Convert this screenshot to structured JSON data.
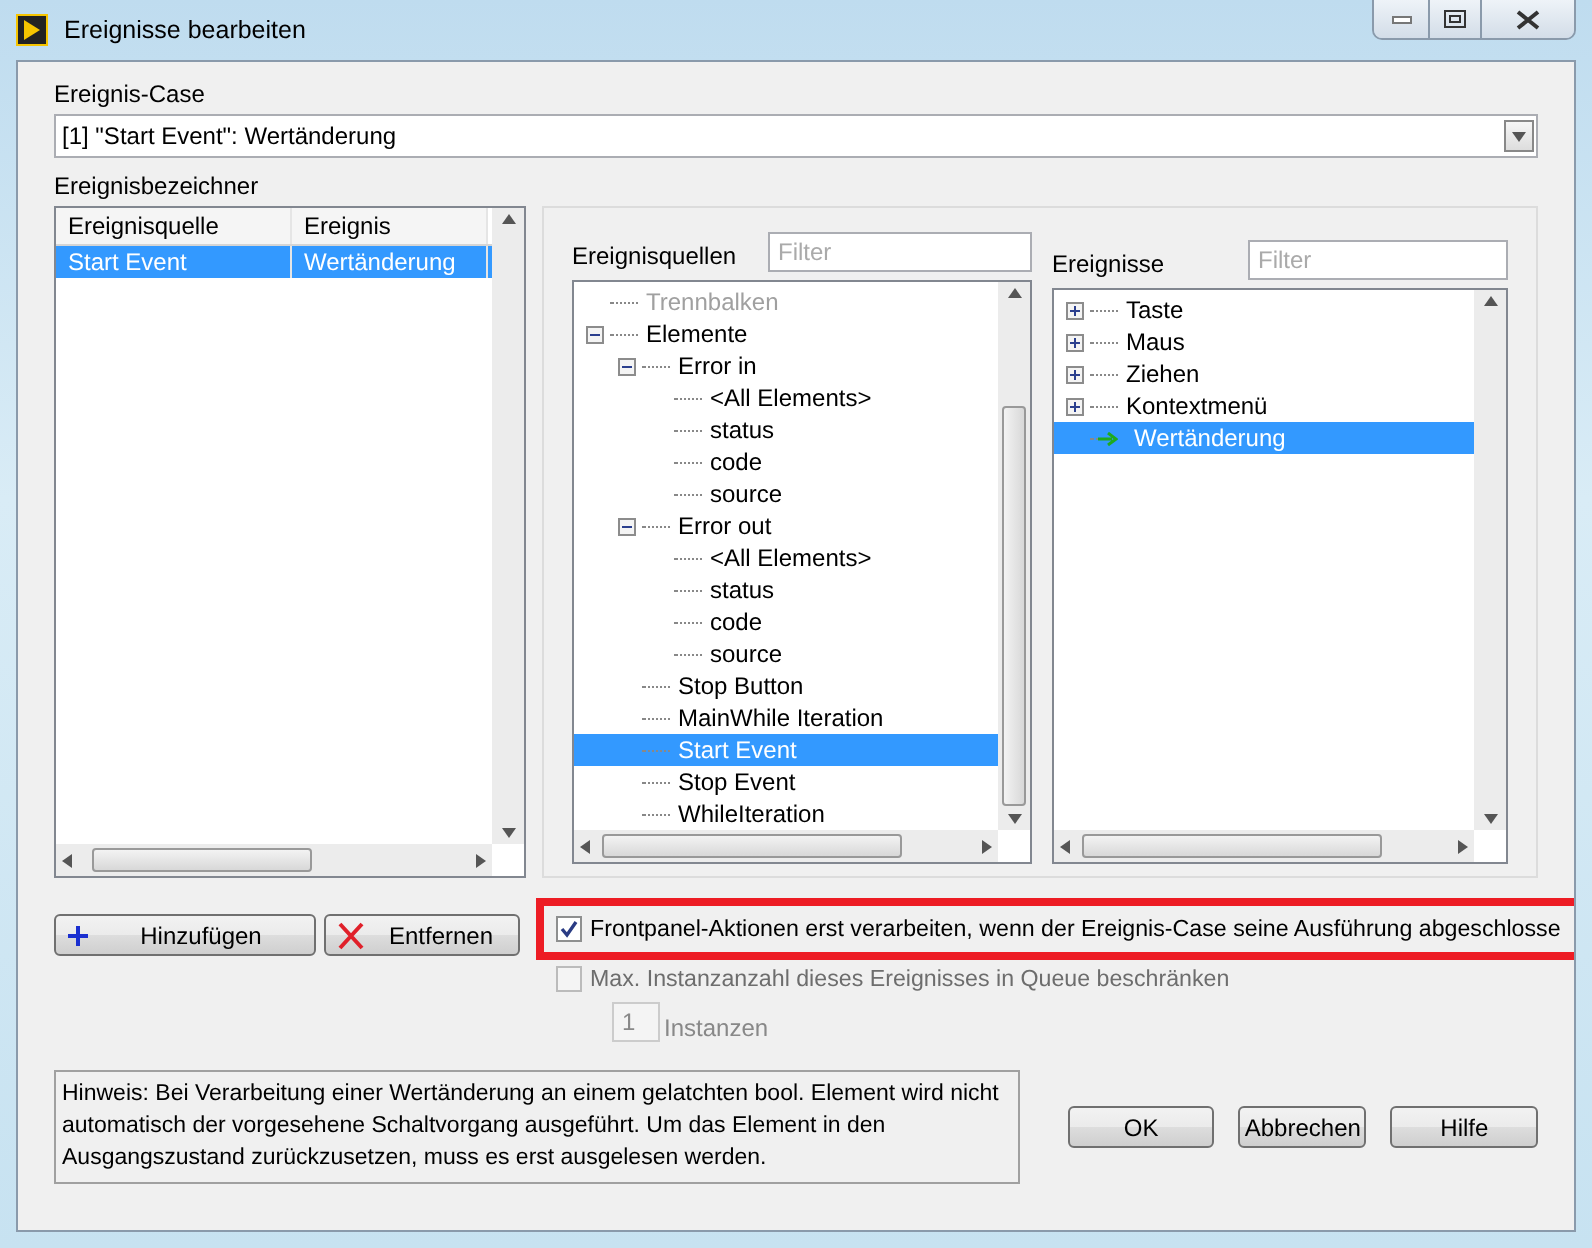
{
  "window": {
    "title": "Ereignisse bearbeiten"
  },
  "event_case": {
    "label": "Ereignis-Case",
    "value": "[1] \"Start Event\": Wertänderung"
  },
  "identifiers": {
    "label": "Ereignisbezeichner",
    "columns": [
      "Ereignisquelle",
      "Ereignis"
    ],
    "rows": [
      {
        "cells": [
          "Start Event",
          "Wertänderung"
        ],
        "selected": true
      }
    ]
  },
  "sources": {
    "label": "Ereignisquellen",
    "filter_placeholder": "Filter",
    "tree": [
      {
        "label": "Trennbalken",
        "disabled": true,
        "selected": false
      },
      {
        "label": "Elemente",
        "disabled": false,
        "selected": false,
        "expanded": true,
        "children": [
          {
            "label": "Error in",
            "disabled": false,
            "selected": false,
            "expanded": true,
            "children": [
              {
                "label": "<All Elements>",
                "disabled": false,
                "selected": false
              },
              {
                "label": "status",
                "disabled": false,
                "selected": false
              },
              {
                "label": "code",
                "disabled": false,
                "selected": false
              },
              {
                "label": "source",
                "disabled": false,
                "selected": false
              }
            ]
          },
          {
            "label": "Error out",
            "disabled": false,
            "selected": false,
            "expanded": true,
            "children": [
              {
                "label": "<All Elements>",
                "disabled": false,
                "selected": false
              },
              {
                "label": "status",
                "disabled": false,
                "selected": false
              },
              {
                "label": "code",
                "disabled": false,
                "selected": false
              },
              {
                "label": "source",
                "disabled": false,
                "selected": false
              }
            ]
          },
          {
            "label": "Stop Button",
            "disabled": false,
            "selected": false
          },
          {
            "label": "MainWhile Iteration",
            "disabled": false,
            "selected": false
          },
          {
            "label": "Start Event",
            "disabled": false,
            "selected": true
          },
          {
            "label": "Stop Event",
            "disabled": false,
            "selected": false
          },
          {
            "label": "WhileIteration",
            "disabled": false,
            "selected": false
          }
        ]
      }
    ]
  },
  "events": {
    "label": "Ereignisse",
    "filter_placeholder": "Filter",
    "tree": [
      {
        "label": "Taste",
        "disabled": false,
        "selected": false,
        "expanded": false
      },
      {
        "label": "Maus",
        "disabled": false,
        "selected": false,
        "expanded": false
      },
      {
        "label": "Ziehen",
        "disabled": false,
        "selected": false,
        "expanded": false
      },
      {
        "label": "Kontextmenü",
        "disabled": false,
        "selected": false,
        "expanded": false
      },
      {
        "label": "Wertänderung",
        "disabled": false,
        "selected": true
      }
    ]
  },
  "list_buttons": [
    {
      "label": "Hinzufügen",
      "kind": "add"
    },
    {
      "label": "Entfernen",
      "kind": "remove"
    }
  ],
  "options": [
    {
      "label": "Frontpanel-Aktionen erst verarbeiten, wenn der Ereignis-Case seine Ausführung  abgeschlosse",
      "checked": true,
      "disabled": false
    },
    {
      "label": "Max. Instanzanzahl dieses Ereignisses in Queue beschränken",
      "checked": false,
      "disabled": true
    }
  ],
  "instances": {
    "value": "1",
    "label": "Instanzen",
    "disabled": true
  },
  "note": "Hinweis:  Bei Verarbeitung einer Wertänderung an einem gelatchten bool. Element wird nicht automatisch der vorgesehene Schaltvorgang ausgeführt. Um das Element in den Ausgangszustand zurückzusetzen, muss es erst ausgelesen werden.",
  "buttons": [
    "OK",
    "Abbrechen",
    "Hilfe"
  ],
  "annotation": {
    "kind": "frame"
  }
}
